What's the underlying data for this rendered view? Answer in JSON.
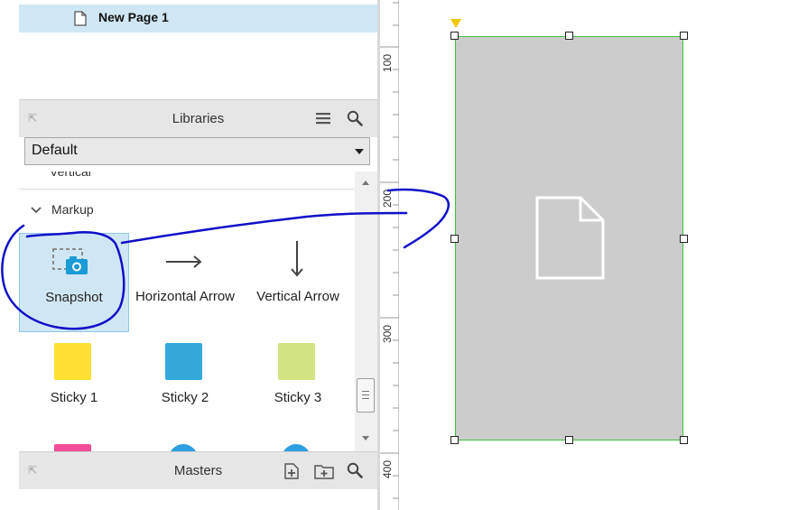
{
  "pages": {
    "items": [
      {
        "label": "New Page 1"
      }
    ]
  },
  "libraries": {
    "title": "Libraries",
    "dropdown_value": "Default",
    "prev_section_partial": "Vertical",
    "section": "Markup",
    "widgets": [
      {
        "label": "Snapshot",
        "icon": "snapshot-icon",
        "selected": true
      },
      {
        "label": "Horizontal Arrow",
        "icon": "horizontal-arrow-icon"
      },
      {
        "label": "Vertical Arrow",
        "icon": "vertical-arrow-icon"
      },
      {
        "label": "Sticky 1",
        "icon": "sticky-icon",
        "color": "#ffe033"
      },
      {
        "label": "Sticky 2",
        "icon": "sticky-icon",
        "color": "#33a8d9"
      },
      {
        "label": "Sticky 3",
        "icon": "sticky-icon",
        "color": "#d2e382"
      }
    ],
    "partial_row_colors": [
      "#f04e98",
      "#2d9ee0",
      "#2d9ee0"
    ]
  },
  "masters": {
    "title": "Masters"
  },
  "ruler": {
    "labels": [
      "100",
      "200",
      "300",
      "400"
    ]
  },
  "canvas": {
    "shape": {
      "type": "placeholder",
      "fill": "#cccccc",
      "border": "#3ec13e",
      "icon": "document-icon"
    }
  },
  "colors": {
    "selection": "#cfe7f5",
    "annotation_stroke": "#1010c8"
  }
}
